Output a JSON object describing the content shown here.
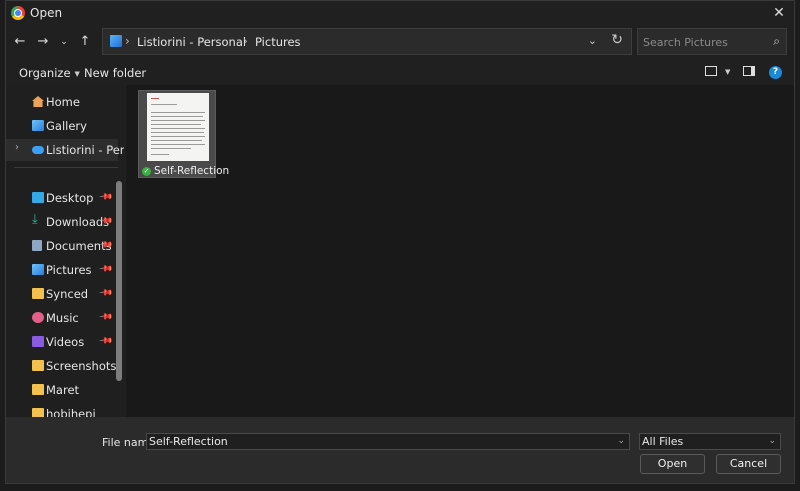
{
  "window": {
    "title": "Open"
  },
  "navigation": {
    "breadcrumb": [
      "Listiorini - Personal",
      "Pictures"
    ],
    "search_placeholder": "Search Pictures"
  },
  "toolbar": {
    "organize": "Organize",
    "new_folder": "New folder"
  },
  "sidebar": {
    "items": [
      {
        "label": "Home",
        "icon": "home-icon",
        "pinned": false
      },
      {
        "label": "Gallery",
        "icon": "gallery-icon",
        "pinned": false
      },
      {
        "label": "Listiorini - Personal",
        "icon": "onedrive-cloud-icon",
        "pinned": false,
        "selected": true
      },
      {
        "label": "Desktop",
        "icon": "desktop-folder-icon",
        "pinned": true
      },
      {
        "label": "Downloads",
        "icon": "download-icon",
        "pinned": true
      },
      {
        "label": "Documents",
        "icon": "documents-icon",
        "pinned": true
      },
      {
        "label": "Pictures",
        "icon": "pictures-icon",
        "pinned": true
      },
      {
        "label": "Synced",
        "icon": "folder-icon",
        "pinned": true
      },
      {
        "label": "Music",
        "icon": "music-icon",
        "pinned": true
      },
      {
        "label": "Videos",
        "icon": "videos-icon",
        "pinned": true
      },
      {
        "label": "Screenshots",
        "icon": "folder-icon",
        "pinned": false
      },
      {
        "label": "Maret",
        "icon": "folder-icon",
        "pinned": false
      },
      {
        "label": "hobihepi",
        "icon": "folder-icon",
        "pinned": false
      }
    ]
  },
  "files": [
    {
      "name": "Self-Reflection",
      "status": "synced"
    }
  ],
  "footer": {
    "filename_label": "File name:",
    "filename_value": "Self-Reflection",
    "filetype_value": "All Files",
    "open_label": "Open",
    "cancel_label": "Cancel"
  },
  "colors": {
    "accent": "#1a8ad8",
    "background": "#202020",
    "sync_ok": "#3cb043"
  }
}
